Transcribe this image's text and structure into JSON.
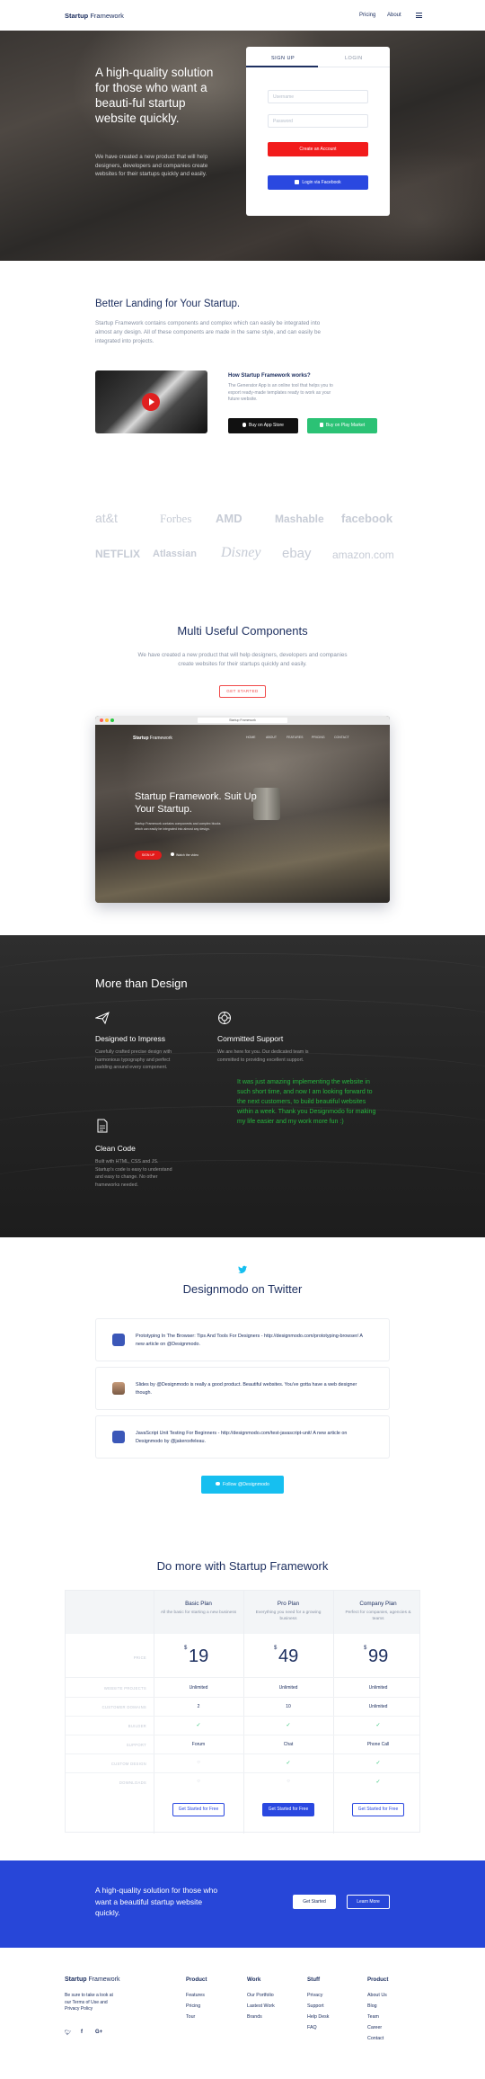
{
  "header": {
    "brand_bold": "Startup",
    "brand_light": "Framework",
    "nav": [
      "Pricing",
      "About"
    ],
    "menu_icon": "hamburger-icon"
  },
  "hero": {
    "title": "A high-quality solution for those who want a beauti-ful startup website quickly.",
    "subtitle": "We have created a new product that will help designers, developers and companies create websites for their startups quickly and easily.",
    "tabs": [
      "SIGN UP",
      "LOGIN"
    ],
    "username_placeholder": "Username",
    "password_placeholder": "Password",
    "create_button": "Create an Account",
    "facebook_button": "Login via Facebook"
  },
  "landing": {
    "title": "Better Landing for Your Startup.",
    "text": "Startup Framework contains components and complex which can easily be integrated into almost any design. All of these components are made in the same style, and can easily be integrated into projects.",
    "how_title": "How Startup Framework works?",
    "how_text": "The Generator App is an online tool that helps you to export ready-made templates ready to work as your future website.",
    "app_store": "Buy on App Store",
    "play_market": "Buy on Play Market"
  },
  "logos": {
    "row1": [
      "at&t",
      "Forbes",
      "AMD",
      "Mashable",
      "facebook"
    ],
    "row2": [
      "NETFLIX",
      "Atlassian",
      "Disney",
      "ebay",
      "amazon.com"
    ]
  },
  "components": {
    "title": "Multi Useful Components",
    "text": "We have created a new product that will help designers, developers and companies create websites for their startups quickly and easily.",
    "button": "GET STARTED",
    "mock_url": "Startup Framework",
    "mock_brand_bold": "Startup",
    "mock_brand_light": "Framework",
    "mock_nav": [
      "HOME",
      "ABOUT",
      "FEATURES",
      "PRICING",
      "CONTACT"
    ],
    "mock_title": "Startup Framework. Suit Up Your Startup.",
    "mock_text": "Startup Framework contains components and complex blocks which can easily be integrated into almost any design.",
    "mock_button": "SIGN UP",
    "mock_link": "Watch the video"
  },
  "design": {
    "title": "More than Design",
    "features": [
      {
        "title": "Designed to Impress",
        "text": "Carefully crafted precise design with harmonious typography and perfect padding around every component.",
        "icon": "paper-plane-icon"
      },
      {
        "title": "Committed Support",
        "text": "We are here for you. Our dedicated team is committed to providing excellent support.",
        "icon": "lifebuoy-icon"
      },
      {
        "title": "Clean Code",
        "text": "Built with HTML, CSS and JS. Startup's code is easy to understand and easy to change. No other frameworks needed.",
        "icon": "document-icon"
      }
    ],
    "quote": "It was just amazing implementing the website in such short time, and now I am looking forward to the next customers, to build beautiful websites within a week. Thank you Designmodo for making my life easier and my work more fun :)"
  },
  "twitter": {
    "title": "Designmodo on Twitter",
    "tweets": [
      "Prototyping In The Browser: Tips And Tools For Designers - http://designmodo.com/prototyping-browser/ A new article on @Designmodo.",
      "Slides by @Designmodo is really a good product. Beautiful websites. You've gotta have a web designer though.",
      "JavaScript Unit Testing For Beginners - http://designmodo.com/test-javascript-unit/ A new article on Designmodo by @jakeroxfeleau."
    ],
    "follow_button": "Follow @Designmodo"
  },
  "pricing": {
    "title": "Do more with Startup Framework",
    "plans": [
      {
        "name": "Basic Plan",
        "desc": "All the basic for starting a new business",
        "price": "19",
        "button": "Get Started for Free"
      },
      {
        "name": "Pro Plan",
        "desc": "Everything you need for a growing business",
        "price": "49",
        "button": "Get Started for Free"
      },
      {
        "name": "Company Plan",
        "desc": "Perfect for companies, agencies & teams",
        "price": "99",
        "button": "Get Started for Free"
      }
    ],
    "currency": "$",
    "row_labels": [
      "PRICE",
      "WEBSITE PROJECTS",
      "CUSTOMER DOMAINS",
      "BUILDER",
      "SUPPORT",
      "CUSTOM DESIGN",
      "DOWNLOADS"
    ],
    "rows": [
      [
        "Unlimited",
        "Unlimited",
        "Unlimited"
      ],
      [
        "2",
        "10",
        "Unlimited"
      ],
      [
        "check",
        "check",
        "check"
      ],
      [
        "Forum",
        "Chat",
        "Phone Call"
      ],
      [
        "dash",
        "check",
        "check"
      ],
      [
        "dash",
        "dash",
        "check"
      ]
    ]
  },
  "cta": {
    "text": "A high-quality solution for those who want a beautiful startup website quickly.",
    "button1": "Get Started",
    "button2": "Learn More"
  },
  "footer": {
    "brand_bold": "Startup",
    "brand_light": "Framework",
    "text": "Be sure to take a look at our Terms of Use and Privacy Policy",
    "social": [
      "twitter-icon",
      "facebook-icon",
      "google-plus-icon"
    ],
    "columns": [
      {
        "title": "Product",
        "links": [
          "Features",
          "Pricing",
          "Tour"
        ]
      },
      {
        "title": "Work",
        "links": [
          "Our Portfolio",
          "Lastest Work",
          "Brands"
        ]
      },
      {
        "title": "Stuff",
        "links": [
          "Privacy",
          "Support",
          "Help Desk",
          "FAQ"
        ]
      },
      {
        "title": "Product",
        "links": [
          "About Us",
          "Blog",
          "Team",
          "Career",
          "Contact"
        ]
      }
    ]
  },
  "colors": {
    "navy": "#1e3060",
    "red": "#f21b1b",
    "blue": "#2a48e0",
    "green": "#25b83e",
    "twitter": "#16bff0"
  }
}
